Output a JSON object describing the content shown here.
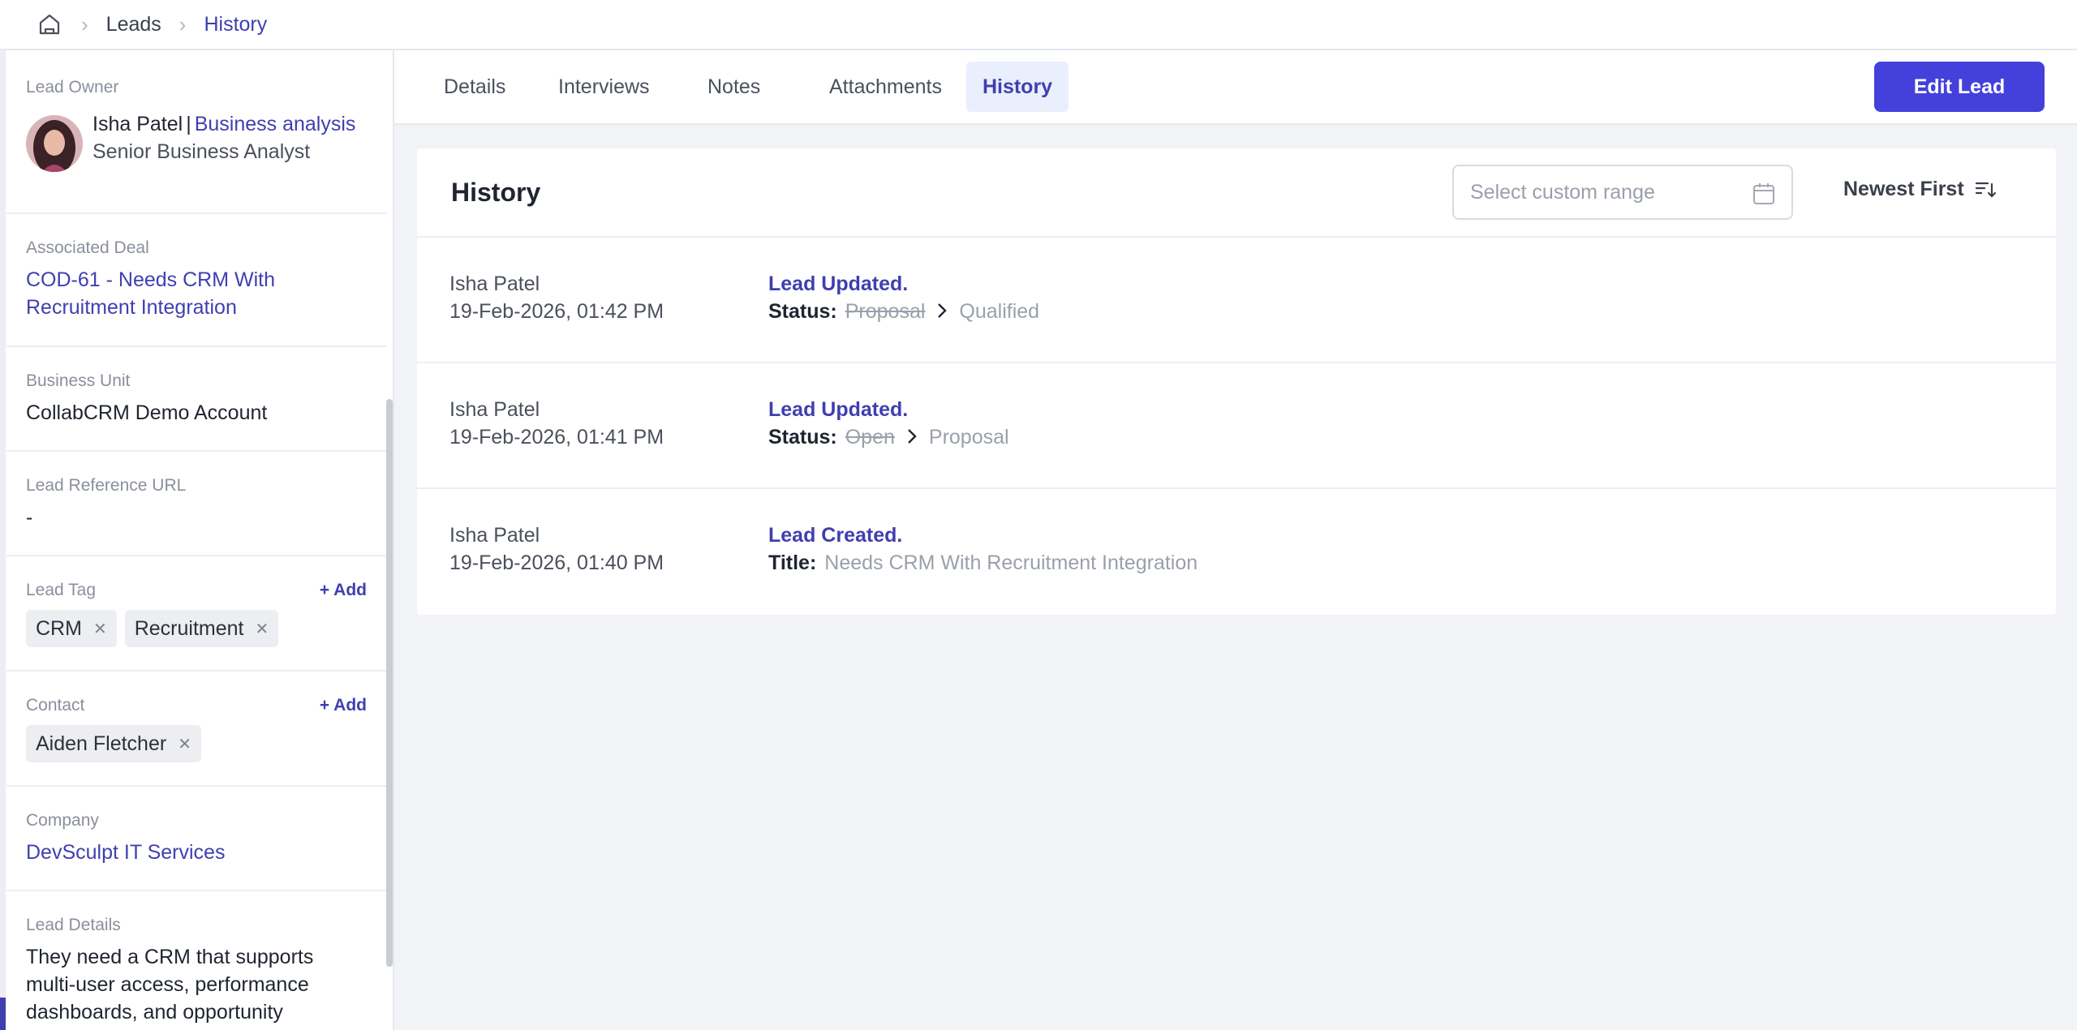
{
  "breadcrumb": {
    "home_icon": "home-icon",
    "items": [
      "Leads",
      "History"
    ]
  },
  "sidebar": {
    "lead_owner": {
      "label": "Lead Owner",
      "name": "Isha Patel",
      "separator": "|",
      "department": "Business analysis",
      "role": "Senior Business Analyst"
    },
    "associated_deal": {
      "label": "Associated Deal",
      "value": "COD-61 - Needs CRM With Recruitment Integration"
    },
    "business_unit": {
      "label": "Business Unit",
      "value": "CollabCRM Demo Account"
    },
    "lead_reference_url": {
      "label": "Lead Reference URL",
      "value": "-"
    },
    "lead_tag": {
      "label": "Lead Tag",
      "add_label": "+ Add",
      "chips": [
        "CRM",
        "Recruitment"
      ]
    },
    "contact": {
      "label": "Contact",
      "add_label": "+ Add",
      "chips": [
        "Aiden Fletcher"
      ]
    },
    "company": {
      "label": "Company",
      "value": "DevSculpt IT Services"
    },
    "lead_details": {
      "label": "Lead Details",
      "value": "They need a CRM that supports multi-user access, performance dashboards, and opportunity"
    }
  },
  "tabs": [
    "Details",
    "Interviews",
    "Notes",
    "Attachments",
    "History"
  ],
  "active_tab": "History",
  "edit_button": "Edit Lead",
  "history": {
    "title": "History",
    "range_placeholder": "Select custom range",
    "sort_label": "Newest First",
    "entries": [
      {
        "user": "Isha Patel",
        "timestamp": "19-Feb-2026, 01:42 PM",
        "action": "Lead Updated.",
        "field": "Status:",
        "old_value": "Proposal",
        "new_value": "Qualified"
      },
      {
        "user": "Isha Patel",
        "timestamp": "19-Feb-2026, 01:41 PM",
        "action": "Lead Updated.",
        "field": "Status:",
        "old_value": "Open",
        "new_value": "Proposal"
      },
      {
        "user": "Isha Patel",
        "timestamp": "19-Feb-2026, 01:40 PM",
        "action": "Lead Created.",
        "field": "Title:",
        "old_value": "",
        "new_value": "Needs CRM With Recruitment Integration"
      }
    ]
  },
  "colors": {
    "accent": "#3f3fb0",
    "primary_button": "#4340dc",
    "active_tab_bg": "#e9effc",
    "muted_text": "#9aa0ab"
  }
}
